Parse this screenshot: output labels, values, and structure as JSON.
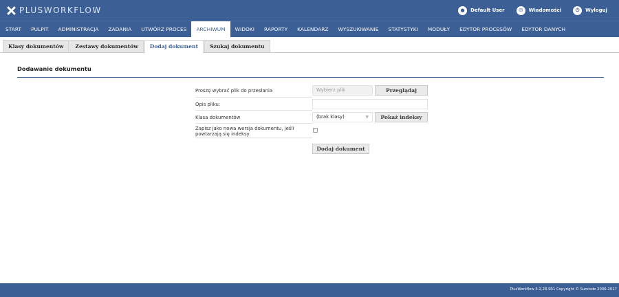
{
  "app": {
    "logo_text": "PLUSWORKFLOW"
  },
  "user_menu": [
    {
      "icon": "user-icon",
      "glyph": "●",
      "label": "Default User"
    },
    {
      "icon": "envelope-icon",
      "glyph": "✉",
      "label": "Wiadomości"
    },
    {
      "icon": "power-icon",
      "glyph": "⏻",
      "label": "Wyloguj"
    }
  ],
  "menu": [
    {
      "label": "START"
    },
    {
      "label": "PULPIT"
    },
    {
      "label": "ADMINISTRACJA"
    },
    {
      "label": "ZADANIA"
    },
    {
      "label": "UTWÓRZ PROCES"
    },
    {
      "label": "ARCHIWUM",
      "active": true
    },
    {
      "label": "WIDOKI"
    },
    {
      "label": "RAPORTY"
    },
    {
      "label": "KALENDARZ"
    },
    {
      "label": "WYSZUKIWANIE"
    },
    {
      "label": "STATYSTYKI"
    },
    {
      "label": "MODUŁY"
    },
    {
      "label": "EDYTOR PROCESÓW"
    },
    {
      "label": "EDYTOR DANYCH"
    }
  ],
  "tabs": [
    {
      "label": "Klasy dokumentów"
    },
    {
      "label": "Zestawy dokumentów"
    },
    {
      "label": "Dodaj dokument",
      "active": true
    },
    {
      "label": "Szukaj dokumentu"
    }
  ],
  "section": {
    "title": "Dodawanie dokumentu"
  },
  "form": {
    "file_label": "Proszę wybrać plik do przesłania",
    "file_placeholder": "Wybierz plik",
    "browse_button": "Przeglądaj",
    "description_label": "Opis pliku:",
    "description_value": "",
    "doc_class_label": "Klasa dokumentów",
    "doc_class_value": "(brak klasy)",
    "show_indexes_button": "Pokaż indeksy",
    "new_version_label": "Zapisz jako nowa wersja dokumentu, jeśli powtarzają się indeksy",
    "new_version_checked": false,
    "submit_button": "Dodaj dokument"
  },
  "footer": {
    "text": "PlusWorkflow 3.2.28.SR1 Copyright © Suncode 2006-2017"
  },
  "colors": {
    "brand": "#3c5f95",
    "tab_bg": "#e6e6e6",
    "button_bg": "#eaeaea"
  }
}
